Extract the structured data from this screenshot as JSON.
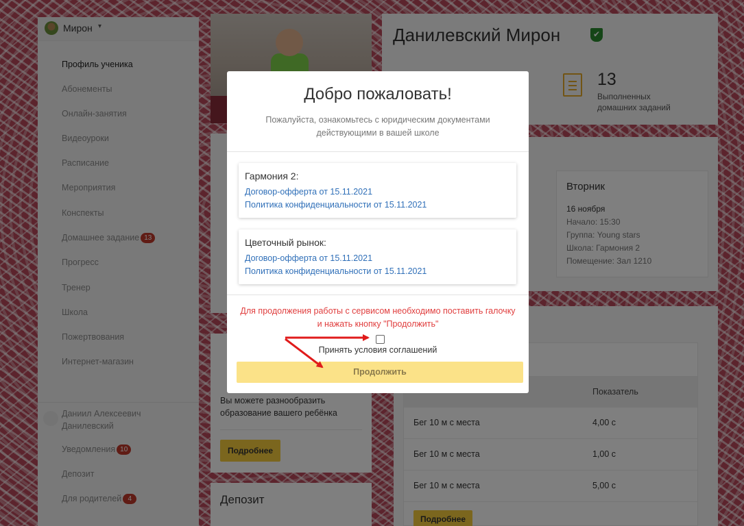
{
  "sidebar": {
    "user_name": "Мирон",
    "caret": "▾",
    "items": [
      {
        "label": "Профиль ученика"
      },
      {
        "label": "Абонементы"
      },
      {
        "label": "Онлайн-занятия"
      },
      {
        "label": "Видеоуроки"
      },
      {
        "label": "Расписание"
      },
      {
        "label": "Мероприятия"
      },
      {
        "label": "Конспекты"
      },
      {
        "label": "Домашнее задание",
        "badge": "13"
      },
      {
        "label": "Прогресс"
      },
      {
        "label": "Тренер"
      },
      {
        "label": "Школа"
      },
      {
        "label": "Пожертвования"
      },
      {
        "label": "Интернет-магазин"
      }
    ],
    "parent_name_line1": "Даниил Алексеевич",
    "parent_name_line2": "Данилевский",
    "parent_items": [
      {
        "label": "Уведомления",
        "badge": "10"
      },
      {
        "label": "Депозит"
      },
      {
        "label": "Для родителей",
        "badge": "4"
      }
    ]
  },
  "middle": {
    "card2_text_line1": "Вы можете разнообразить",
    "card2_text_line2": "образование вашего ребёнка",
    "card2_button": "Подробнее",
    "card3_title": "Депозит"
  },
  "profile": {
    "name": "Данилевский Мирон",
    "shield_check": "✔",
    "homework_count": "13",
    "homework_label_line1": "Выполненных",
    "homework_label_line2": "домашних заданий"
  },
  "schedule": {
    "day": "Вторник",
    "date": "16 ноября",
    "start": "Начало: 15:30",
    "group": "Группа: Young stars",
    "school": "Школа: Гармония 2",
    "room": "Помещение: Зал 1210"
  },
  "progress_table": {
    "header_value": "Показатель",
    "rows": [
      {
        "name": "Бег 10 м с места",
        "value": "4,00 с"
      },
      {
        "name": "Бег 10 м с места",
        "value": "1,00 с"
      },
      {
        "name": "Бег 10 м с места",
        "value": "5,00 с"
      }
    ],
    "button": "Подробнее"
  },
  "modal": {
    "title": "Добро пожаловать!",
    "subtitle_line1": "Пожалуйста, ознакомьтесь с юридическим документами",
    "subtitle_line2": "действующими в вашей школе",
    "documents": [
      {
        "school": "Гармония 2:",
        "offer": "Договор-офферта от 15.11.2021",
        "privacy": "Политика конфиденциальности от 15.11.2021"
      },
      {
        "school": "Цветочный рынок:",
        "offer": "Договор-офферта от 15.11.2021",
        "privacy": "Политика конфиденциальности от 15.11.2021"
      }
    ],
    "warning_line1": "Для продолжения работы с сервисом необходимо поставить галочку",
    "warning_line2": "и нажать кнопку \"Продолжить\"",
    "checkbox_label": "Принять условия соглашений",
    "continue_button": "Продолжить"
  },
  "colors": {
    "accent_yellow": "#f6cd3d",
    "badge_red": "#c0392b",
    "link_blue": "#2f6fb8",
    "warning_red": "#e03d3d",
    "annotation_arrow": "#e01b1b"
  }
}
